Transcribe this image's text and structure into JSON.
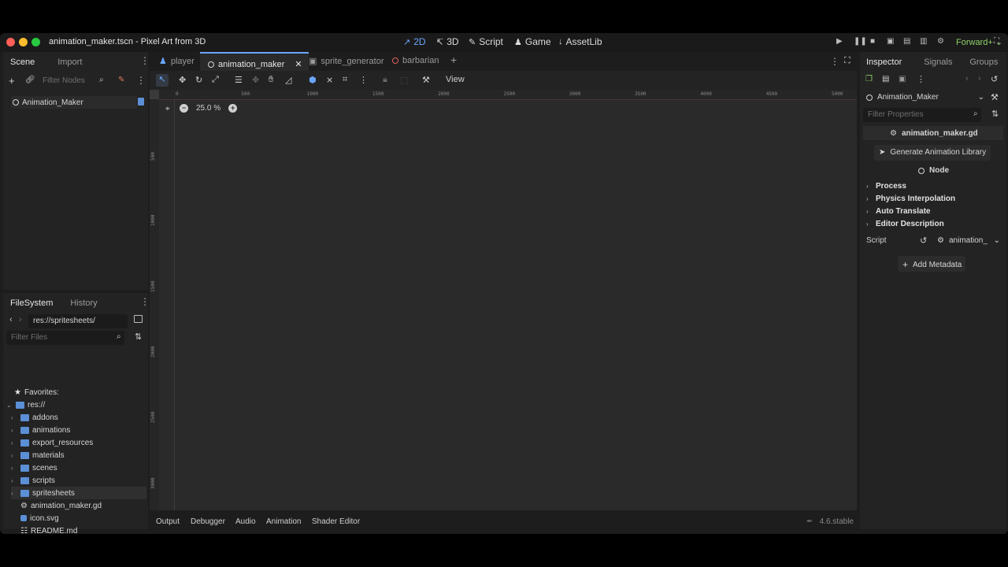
{
  "window": {
    "title": "animation_maker.tscn - Pixel Art from 3D",
    "workspaces": [
      {
        "label": "2D",
        "icon": "2d-icon",
        "active": true
      },
      {
        "label": "3D",
        "icon": "3d-icon",
        "active": false
      },
      {
        "label": "Script",
        "icon": "script-icon",
        "active": false
      },
      {
        "label": "Game",
        "icon": "game-icon",
        "active": false
      },
      {
        "label": "AssetLib",
        "icon": "assetlib-icon",
        "active": false
      }
    ],
    "renderer": "Forward+"
  },
  "scene_dock": {
    "tabs": [
      "Scene",
      "Import"
    ],
    "filter_placeholder": "Filter Nodes",
    "root_node": "Animation_Maker"
  },
  "filesystem_dock": {
    "tabs": [
      "FileSystem",
      "History"
    ],
    "path": "res://spritesheets/",
    "filter_placeholder": "Filter Files",
    "favorites_label": "Favorites:",
    "root": "res://",
    "folders": [
      "addons",
      "animations",
      "export_resources",
      "materials",
      "scenes",
      "scripts",
      "spritesheets"
    ],
    "selected_folder": "spritesheets",
    "files": [
      "animation_maker.gd",
      "icon.svg",
      "README.md"
    ]
  },
  "scene_tabs": [
    "player",
    "animation_maker",
    "sprite_generator",
    "barbarian"
  ],
  "active_scene_tab": "animation_maker",
  "toolbar": {
    "view_label": "View"
  },
  "viewport": {
    "zoom": "25.0 %",
    "ruler_top": [
      "0",
      "500",
      "1000",
      "1500",
      "2000",
      "2500",
      "3000",
      "3500",
      "4000",
      "4500",
      "5000"
    ],
    "ruler_left": [
      "500",
      "1000",
      "1500",
      "2000",
      "2500",
      "3000"
    ]
  },
  "bottom_tabs": [
    "Output",
    "Debugger",
    "Audio",
    "Animation",
    "Shader Editor"
  ],
  "version": "4.6.stable",
  "inspector": {
    "tabs": [
      "Inspector",
      "Signals",
      "Groups"
    ],
    "node_name": "Animation_Maker",
    "filter_placeholder": "Filter Properties",
    "script_name": "animation_maker.gd",
    "generate_button": "Generate Animation Library",
    "class_name": "Node",
    "sections": [
      "Process",
      "Physics Interpolation",
      "Auto Translate",
      "Editor Description"
    ],
    "script_label": "Script",
    "script_value": "animation_",
    "add_metadata": "Add Metadata"
  },
  "colors": {
    "accent": "#6aa6ff",
    "folder": "#5b8fd6",
    "renderer": "#8fd06a",
    "tab_close": "#e06060"
  }
}
